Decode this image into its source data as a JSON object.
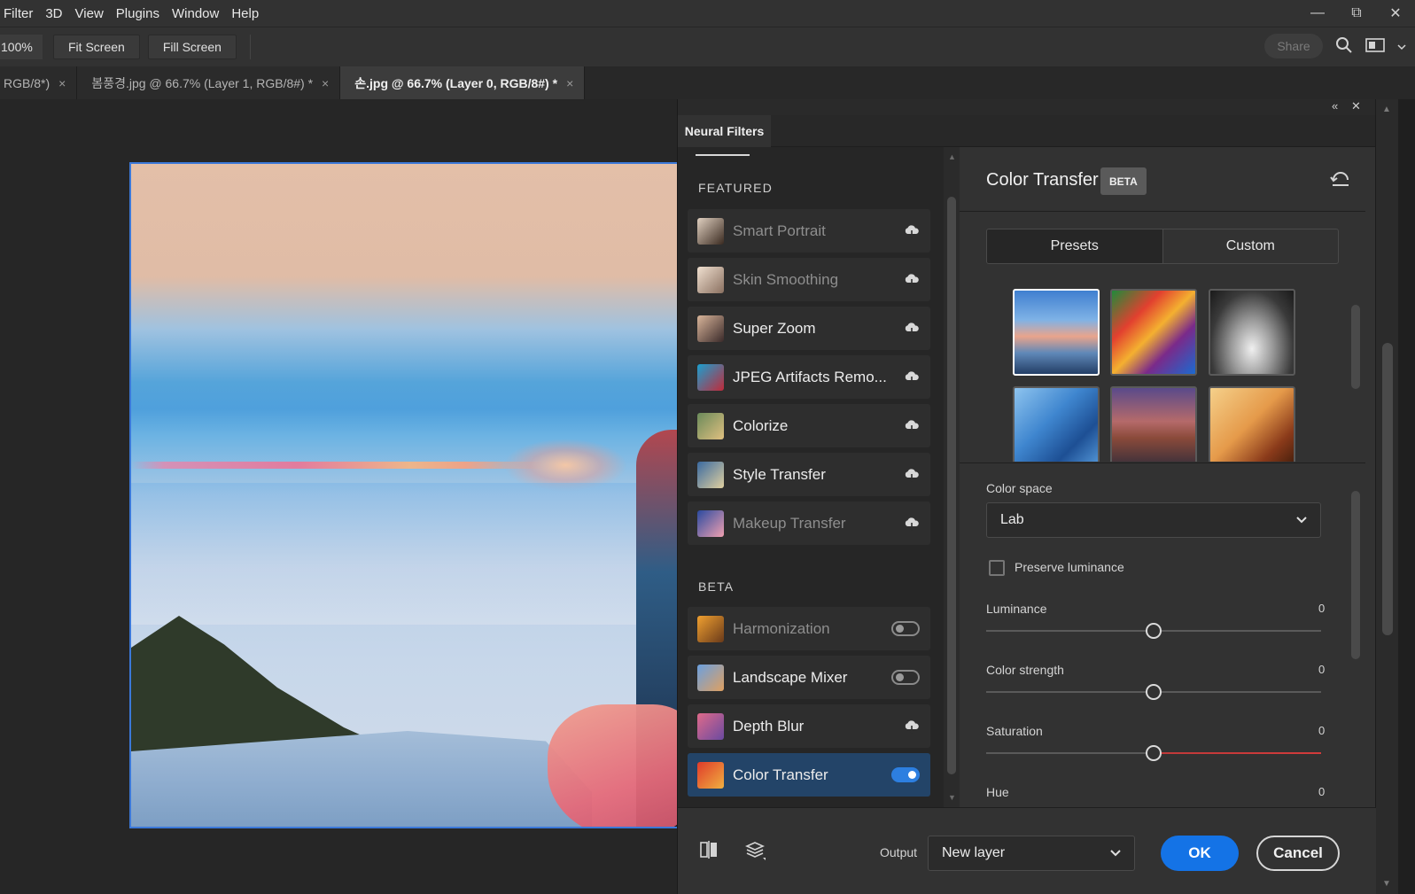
{
  "menubar": {
    "items": [
      "Filter",
      "3D",
      "View",
      "Plugins",
      "Window",
      "Help"
    ]
  },
  "window_controls": {
    "minimize": "—",
    "restore": "⧉",
    "close": "✕"
  },
  "options_bar": {
    "zoom": "100%",
    "fit_screen": "Fit Screen",
    "fill_screen": "Fill Screen",
    "share": "Share"
  },
  "doc_tabs": [
    {
      "label": "RGB/8*)",
      "close": "×",
      "active": false
    },
    {
      "label": "봄풍경.jpg @ 66.7% (Layer 1, RGB/8#) *",
      "close": "×",
      "active": false
    },
    {
      "label": "손.jpg @ 66.7% (Layer 0, RGB/8#) *",
      "close": "×",
      "active": true
    }
  ],
  "neural_filters": {
    "panel_tab": "Neural Filters",
    "panel_controls": {
      "collapse": "«",
      "close": "✕"
    },
    "featured_label": "FEATURED",
    "beta_label": "BETA",
    "featured": [
      {
        "name": "Smart Portrait",
        "state": "download",
        "dim": true
      },
      {
        "name": "Skin Smoothing",
        "state": "download",
        "dim": true
      },
      {
        "name": "Super Zoom",
        "state": "download",
        "dim": false
      },
      {
        "name": "JPEG Artifacts Remo...",
        "state": "download",
        "dim": false
      },
      {
        "name": "Colorize",
        "state": "download",
        "dim": false
      },
      {
        "name": "Style Transfer",
        "state": "download",
        "dim": false
      },
      {
        "name": "Makeup Transfer",
        "state": "download",
        "dim": true
      }
    ],
    "beta": [
      {
        "name": "Harmonization",
        "state": "toggle-off",
        "dim": true
      },
      {
        "name": "Landscape Mixer",
        "state": "toggle-off",
        "dim": false
      },
      {
        "name": "Depth Blur",
        "state": "download",
        "dim": false
      },
      {
        "name": "Color Transfer",
        "state": "toggle-on",
        "dim": false,
        "selected": true
      }
    ]
  },
  "properties": {
    "title": "Color Transfer",
    "badge": "BETA",
    "tabs": {
      "presets": "Presets",
      "custom": "Custom"
    },
    "color_space_label": "Color space",
    "color_space_value": "Lab",
    "preserve_luminance": "Preserve luminance",
    "preserve_luminance_checked": false,
    "sliders": [
      {
        "label": "Luminance",
        "value": "0"
      },
      {
        "label": "Color strength",
        "value": "0"
      },
      {
        "label": "Saturation",
        "value": "0"
      },
      {
        "label": "Hue",
        "value": "0"
      }
    ]
  },
  "footer": {
    "output_label": "Output",
    "output_value": "New layer",
    "ok": "OK",
    "cancel": "Cancel"
  },
  "colors": {
    "accent": "#1473e6",
    "selected_item": "#234468",
    "canvas_border": "#3b78d8"
  }
}
